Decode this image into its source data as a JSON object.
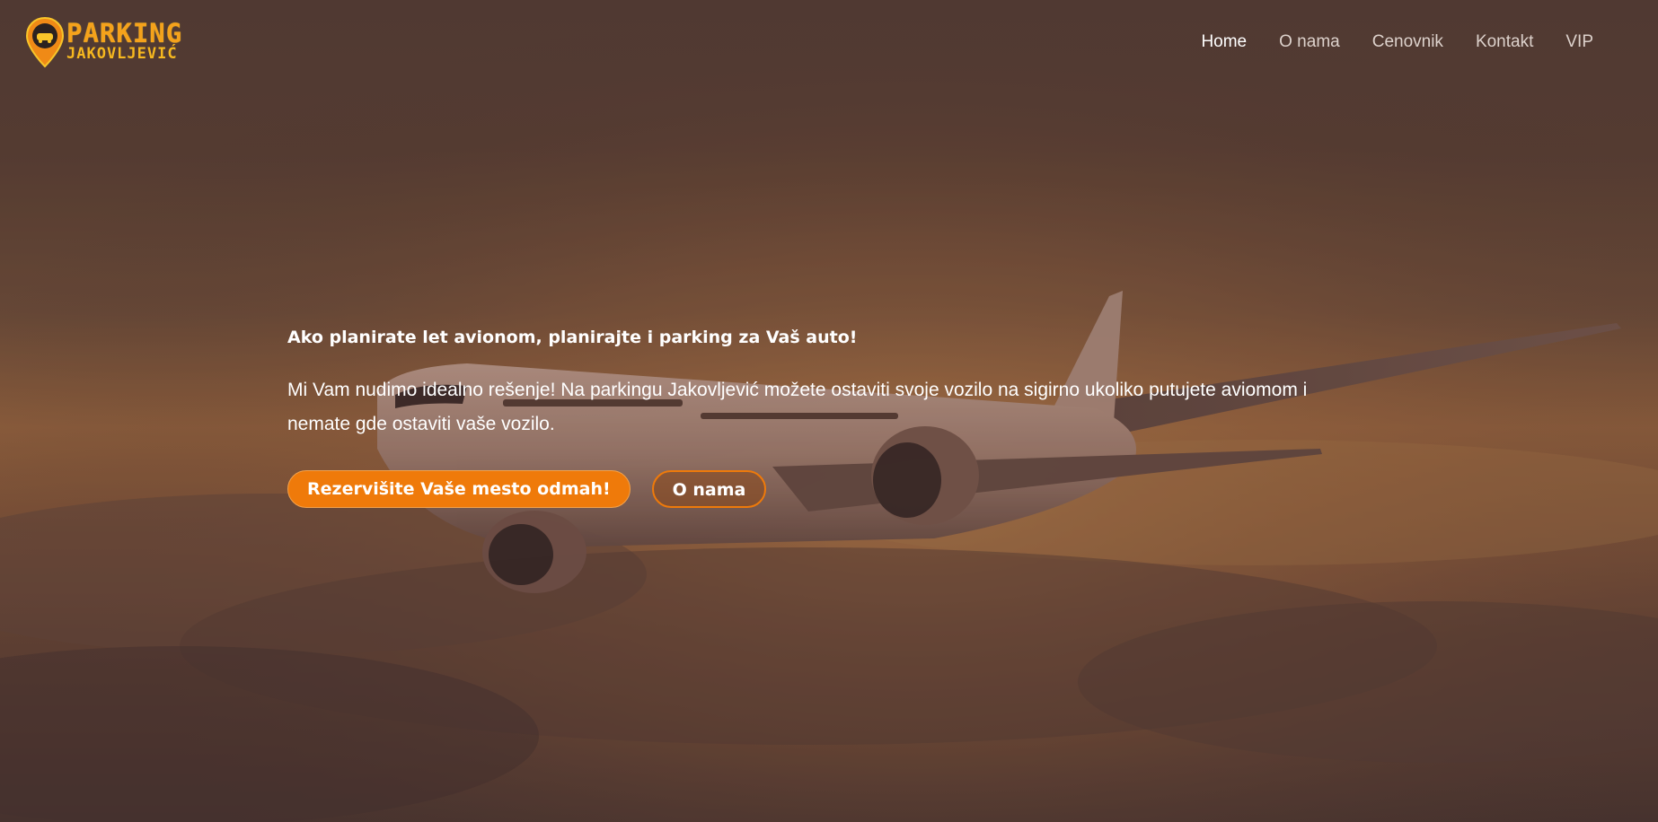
{
  "brand": {
    "line1": "PARKING",
    "line2": "JAKOVLJEVIĆ"
  },
  "nav": {
    "items": [
      {
        "label": "Home",
        "active": true
      },
      {
        "label": "O nama",
        "active": false
      },
      {
        "label": "Cenovnik",
        "active": false
      },
      {
        "label": "Kontakt",
        "active": false
      },
      {
        "label": "VIP",
        "active": false
      }
    ]
  },
  "hero": {
    "headline": "Ako planirate let avionom, planirajte i parking za Vaš auto!",
    "lead": "Mi Vam nudimo idealno rešenje! Na parkingu Jakovljević možete ostaviti svoje vozilo na sigirno ukoliko putujete aviomom i nemate gde ostaviti vaše vozilo.",
    "primary_button": "Rezervišite Vaše mesto odmah!",
    "secondary_button": "O nama"
  },
  "colors": {
    "accent": "#ef7a0a",
    "brand_yellow": "#f6b81f",
    "text": "#ffffff",
    "nav_text": "#ddd2cc"
  },
  "icons": {
    "logo": "map-pin-car-icon",
    "background": "airplane-in-clouds-image"
  }
}
